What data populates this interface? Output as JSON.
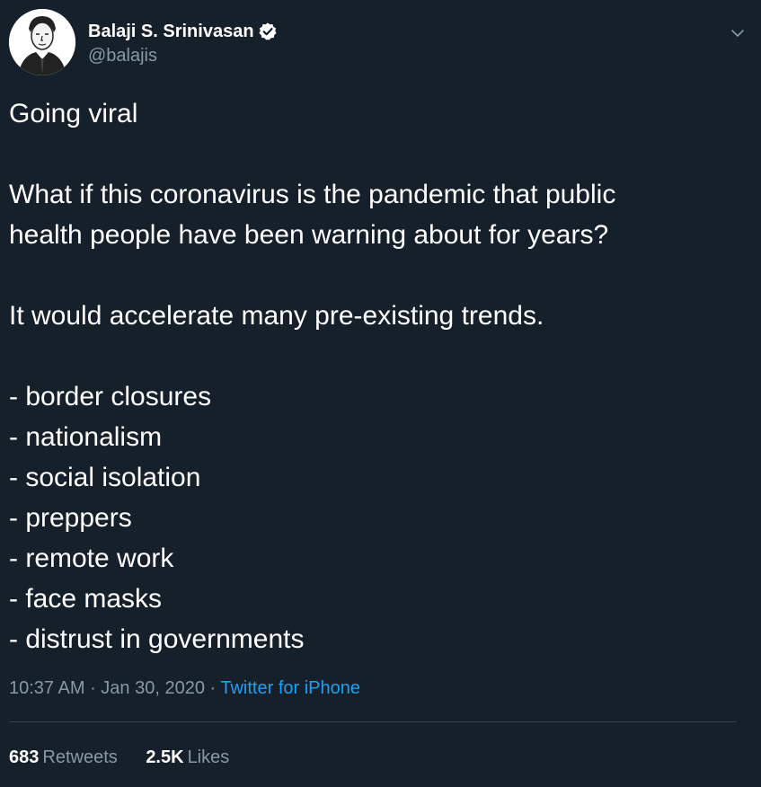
{
  "tweet": {
    "display_name": "Balaji S. Srinivasan",
    "handle": "@balajis",
    "verified": true,
    "lines": [
      "Going viral",
      "",
      "What if this coronavirus is the pandemic that public",
      "health people have been warning about for years?",
      "",
      "It would accelerate many pre-existing trends.",
      "",
      "- border closures",
      "- nationalism",
      "- social isolation",
      "- preppers",
      "- remote work",
      "- face masks",
      "- distrust in governments"
    ],
    "time": "10:37 AM",
    "separator": " · ",
    "date": "Jan 30, 2020",
    "source": "Twitter for iPhone",
    "retweets_count": "683",
    "retweets_label": "Retweets",
    "likes_count": "2.5K",
    "likes_label": "Likes"
  },
  "colors": {
    "background": "#15202b",
    "text": "#ffffff",
    "secondary": "#8899a6",
    "link": "#1da1f2",
    "verified": "#ffffff",
    "divider": "#38444d"
  },
  "icons": {
    "verified": "verified-badge-icon",
    "caret": "chevron-down-icon"
  }
}
